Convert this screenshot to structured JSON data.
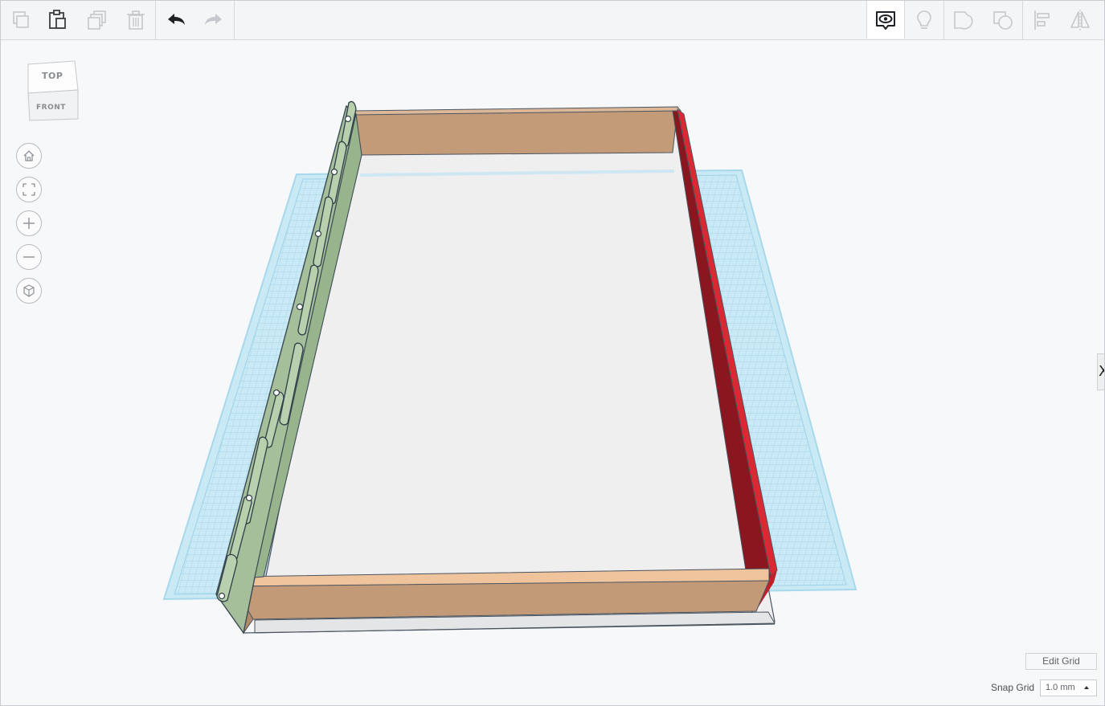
{
  "toolbar": {
    "left_tools": [
      {
        "name": "copy-icon",
        "enabled": false
      },
      {
        "name": "paste-icon",
        "enabled": true
      },
      {
        "name": "duplicate-icon",
        "enabled": false
      },
      {
        "name": "delete-icon",
        "enabled": false
      },
      {
        "name": "undo-icon",
        "enabled": true
      },
      {
        "name": "redo-icon",
        "enabled": false
      }
    ],
    "right_tools": [
      {
        "name": "show-hide-icon",
        "enabled": true,
        "active": true
      },
      {
        "name": "lightbulb-icon",
        "enabled": false
      },
      {
        "name": "group-icon",
        "enabled": false
      },
      {
        "name": "ungroup-icon",
        "enabled": false
      },
      {
        "name": "align-icon",
        "enabled": false
      },
      {
        "name": "mirror-icon",
        "enabled": false
      }
    ]
  },
  "viewcube": {
    "top_label": "TOP",
    "front_label": "FRONT"
  },
  "nav_controls": [
    {
      "name": "home-view-icon"
    },
    {
      "name": "fit-all-icon"
    },
    {
      "name": "zoom-in-icon"
    },
    {
      "name": "zoom-out-icon"
    },
    {
      "name": "perspective-icon"
    }
  ],
  "side_panel_toggle": "X",
  "grid_controls": {
    "edit_grid_label": "Edit Grid",
    "snap_grid_label": "Snap Grid",
    "snap_grid_value": "1.0 mm"
  },
  "colors": {
    "workplane": "#b9e2f0",
    "tray_base": "#f1f1f2",
    "wood_walls": "#c59a78",
    "hinge_green": "#a9c39f",
    "red_wall": "#d72831"
  }
}
